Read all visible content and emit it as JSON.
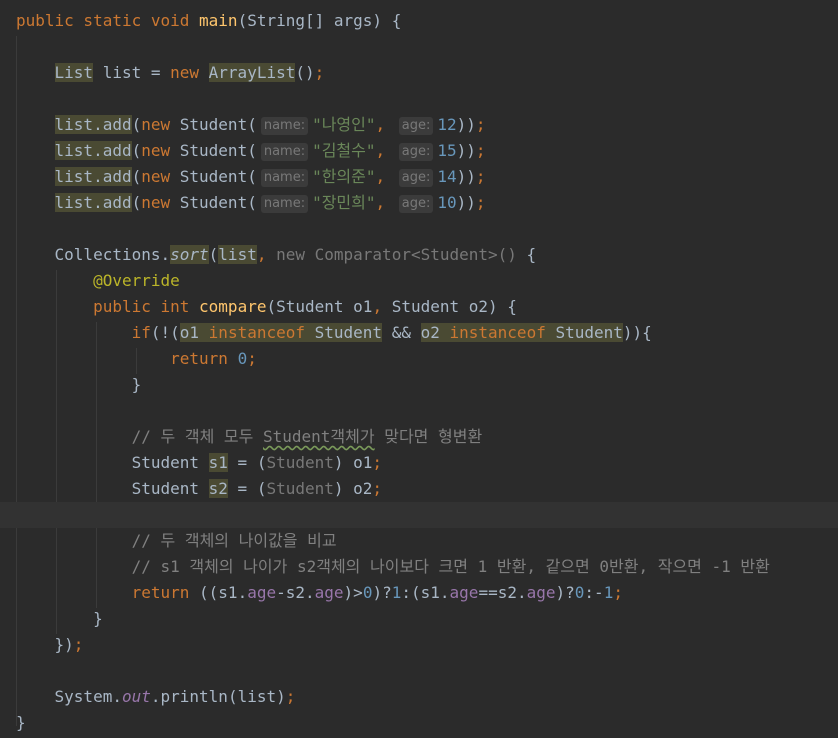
{
  "editor": {
    "language": "Java",
    "current_line": 20,
    "colors": {
      "background": "#2b2b2b",
      "keyword": "#cc7832",
      "method": "#ffc66d",
      "string": "#6a8759",
      "number": "#6897bb",
      "comment": "#808080",
      "field": "#9876aa",
      "annotation": "#bbb529"
    },
    "hints": {
      "name": "name:",
      "age": "age:"
    },
    "students": [
      {
        "name": "\"나영인\"",
        "age": "12"
      },
      {
        "name": "\"김철수\"",
        "age": "15"
      },
      {
        "name": "\"한의준\"",
        "age": "14"
      },
      {
        "name": "\"장민희\"",
        "age": "10"
      }
    ],
    "comments": {
      "cast": "// 두 객체 모두 Student객체가 맞다면 형변환",
      "compare": "// 두 객체의 나이값을 비교",
      "rule": "// s1 객체의 나이가 s2객체의 나이보다 크면 1 반환, 같으면 0반환, 작으면 -1 반환"
    }
  }
}
